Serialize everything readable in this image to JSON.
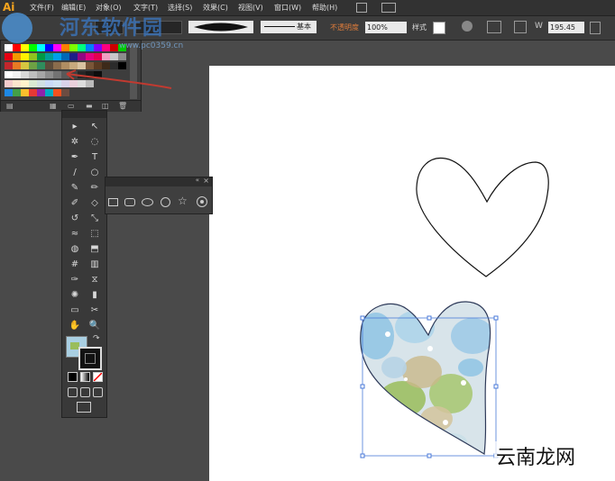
{
  "app": {
    "logo": "Ai"
  },
  "menu": [
    "文件(F)",
    "编辑(E)",
    "对象(O)",
    "文字(T)",
    "选择(S)",
    "效果(C)",
    "视图(V)",
    "窗口(W)",
    "帮助(H)"
  ],
  "control_bar": {
    "stroke_style_label": "基本",
    "opacity_label": "不透明度",
    "opacity_value": "100%",
    "style_label": "样式",
    "width_value": "195.45"
  },
  "swatch_panel": {
    "colors": [
      [
        "#ffffff",
        "#ff0000",
        "#ffff00",
        "#00ff00",
        "#00ffff",
        "#0000ff",
        "#ff00ff",
        "#ff7f00",
        "#7fff00",
        "#00ff7f",
        "#007fff",
        "#7f00ff",
        "#ff007f",
        "#cc0000",
        "#00cc00"
      ],
      [
        "#e60012",
        "#f39800",
        "#fff100",
        "#8fc31f",
        "#009944",
        "#009e96",
        "#00a0e9",
        "#0068b7",
        "#1d2088",
        "#920783",
        "#e4007f",
        "#e5004f",
        "#f19ec2",
        "#c9c9c9",
        "#8c8c8c"
      ],
      [
        "#c1272d",
        "#e87a24",
        "#d6c640",
        "#6da144",
        "#2f8d5d",
        "#5c4b3a",
        "#8a6c4c",
        "#b08d62",
        "#c7a97d",
        "#d9c3a0",
        "#7a5638",
        "#5a3a22",
        "#3d2a1a",
        "#2b2b2b",
        "#000000"
      ],
      [
        "#ffffff",
        "#f2f2f2",
        "#d9d9d9",
        "#bfbfbf",
        "#a6a6a6",
        "#8c8c8c",
        "#737373",
        "#595959",
        "#404040",
        "#262626",
        "#1a1a1a",
        "#0d0d0d"
      ],
      [
        "#f4cccc",
        "#fce5cd",
        "#fff2cc",
        "#d9ead3",
        "#d0e0e3",
        "#c9daf8",
        "#cfe2f3",
        "#d9d2e9",
        "#ead1dc",
        "#dddddd",
        "#bbbbbb"
      ],
      [
        "#1e88e5",
        "#43a047",
        "#fbc02d",
        "#e53935",
        "#8e24aa",
        "#00acc1",
        "#f4511e",
        "#6d4c41"
      ]
    ]
  },
  "toolbox": {
    "tools": [
      "selection-tool",
      "direct-selection-tool",
      "magic-wand-tool",
      "lasso-tool",
      "pen-tool",
      "type-tool",
      "line-tool",
      "ellipse-tool",
      "paintbrush-tool",
      "pencil-tool",
      "blob-brush-tool",
      "eraser-tool",
      "rotate-tool",
      "scale-tool",
      "warp-tool",
      "free-transform-tool",
      "shape-builder-tool",
      "perspective-grid-tool",
      "mesh-tool",
      "gradient-tool",
      "eyedropper-tool",
      "blend-tool",
      "symbol-sprayer-tool",
      "column-graph-tool",
      "artboard-tool",
      "slice-tool",
      "hand-tool",
      "zoom-tool"
    ],
    "tool_glyphs": [
      "▸",
      "↖",
      "✲",
      "◌",
      "✒",
      "T",
      "/",
      "○",
      "✎",
      "✏",
      "✐",
      "◇",
      "↺",
      "⤡",
      "≈",
      "⬚",
      "◍",
      "⬒",
      "#",
      "▥",
      "✑",
      "⧖",
      "✺",
      "▮",
      "▭",
      "✂",
      "✋",
      "🔍"
    ]
  },
  "watermark": {
    "site_name": "河东软件园",
    "url": "www.pc0359.cn",
    "corner_brand": "云南龙网"
  },
  "colors": {
    "accent_red": "#c23a30",
    "canvas_bg": "#ffffff",
    "app_bg": "#4a4a4a"
  }
}
